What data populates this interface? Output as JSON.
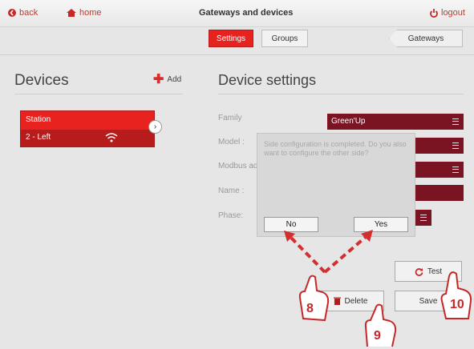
{
  "topbar": {
    "back": "back",
    "home": "home",
    "title": "Gateways and devices",
    "logout": "logout"
  },
  "tabs": {
    "settings": "Settings",
    "groups": "Groups",
    "gateways": "Gateways"
  },
  "left": {
    "title": "Devices",
    "add": "Add",
    "device": {
      "name": "Station",
      "side": "2 - Left"
    }
  },
  "right": {
    "title": "Device settings",
    "family": {
      "label": "Family",
      "value": "Green'Up"
    },
    "model": {
      "label": "Model :"
    },
    "modbus": {
      "label": "Modbus add"
    },
    "name": {
      "label": "Name :"
    },
    "phase": {
      "label": "Phase:"
    }
  },
  "dialog": {
    "message": "Side configuration is completed. Do you also want to configure the other side?",
    "no": "No",
    "yes": "Yes"
  },
  "actions": {
    "test": "Test",
    "delete": "Delete",
    "save": "Save"
  },
  "callouts": {
    "c8": "8",
    "c9": "9",
    "c10": "10"
  },
  "colors": {
    "accent": "#e8221f",
    "field": "#7a1423",
    "callout": "#c62828"
  }
}
